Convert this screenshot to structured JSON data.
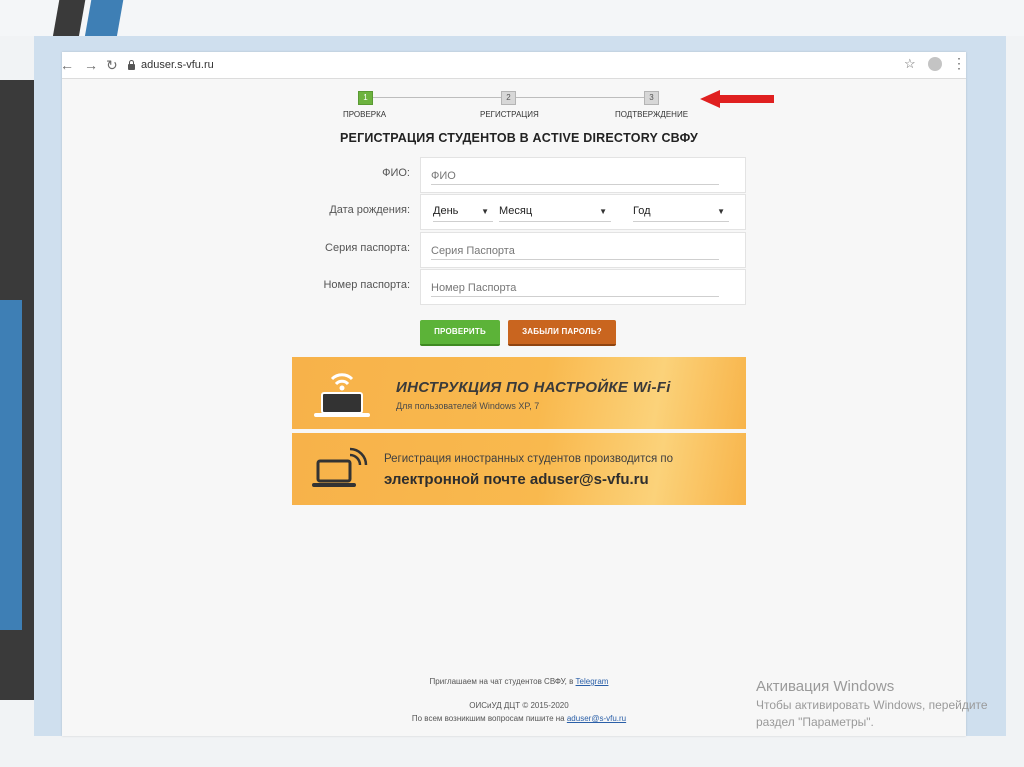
{
  "browser": {
    "url": "aduser.s-vfu.ru",
    "back_icon": "arrow-left-icon",
    "forward_icon": "arrow-right-icon",
    "reload_icon": "reload-icon",
    "bookmark_icon": "star-icon",
    "menu_icon": "kebab-menu-icon"
  },
  "steps": [
    {
      "number": "1",
      "label": "ПРОВЕРКА",
      "active": true
    },
    {
      "number": "2",
      "label": "РЕГИСТРАЦИЯ",
      "active": false
    },
    {
      "number": "3",
      "label": "ПОДТВЕРЖДЕНИЕ",
      "active": false
    }
  ],
  "page_title": "РЕГИСТРАЦИЯ СТУДЕНТОВ В ACTIVE DIRECTORY СВФУ",
  "form": {
    "fio": {
      "label": "ФИО:",
      "placeholder": "ФИО"
    },
    "birth_date": {
      "label": "Дата рождения:",
      "day": "День",
      "month": "Месяц",
      "year": "Год"
    },
    "passport_series": {
      "label": "Серия паспорта:",
      "placeholder": "Серия Паспорта"
    },
    "passport_number": {
      "label": "Номер паспорта:",
      "placeholder": "Номер Паспорта"
    }
  },
  "buttons": {
    "check": "ПРОВЕРИТЬ",
    "forgot": "ЗАБЫЛИ ПАРОЛЬ?"
  },
  "banners": {
    "wifi_title": "ИНСТРУКЦИЯ ПО НАСТРОЙКЕ Wi-Fi",
    "wifi_subtitle": "Для пользователей Windows XP, 7",
    "foreign_line1": "Регистрация иностранных студентов производится по",
    "foreign_line2": "электронной почте aduser@s-vfu.ru"
  },
  "footer": {
    "chat_text": "Приглашаем на чат студентов СВФУ, в ",
    "chat_link": "Telegram",
    "copyright": "ОИСиУД ДЦТ © 2015-2020",
    "contact_text": "По всем возникшим вопросам пишите на ",
    "contact_email": "aduser@s-vfu.ru"
  },
  "watermark": {
    "title": "Активация Windows",
    "line1": "Чтобы активировать Windows, перейдите",
    "line2": "раздел \"Параметры\"."
  },
  "colors": {
    "step_active": "#6db33f",
    "check_button": "#5cb338",
    "forgot_button": "#c9651f",
    "banner": "#f8b44a",
    "arrow": "#e02020"
  }
}
